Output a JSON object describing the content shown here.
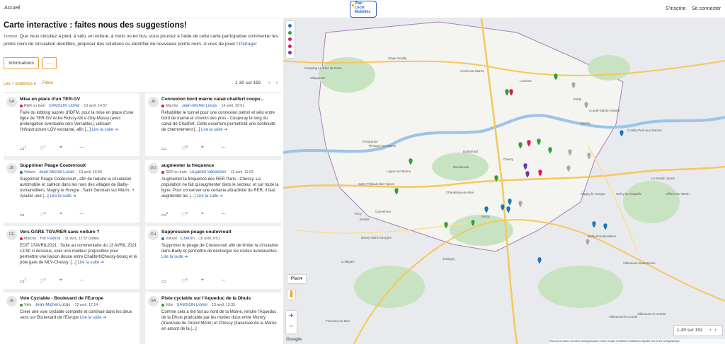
{
  "topbar": {
    "home": "Accueil",
    "logo_line1": "Plan",
    "logo_line2": "Local",
    "logo_line3": "Mobilités",
    "signup": "S'inscrire",
    "login": "Se connecter"
  },
  "header": {
    "title": "Carte interactive : faites nous des suggestions!",
    "status": "Terminé",
    "description": "Que vous circuliez à pied, à vélo, en voiture, à moto ou en bus, vous pourrez à l'aide de cette carte participative commenter les points noirs de circulation identifiés, proposer des solutions ou identifier de nouveaux points noirs. A vous de jouer ! ",
    "share": "Partager",
    "info_button": "Informations",
    "more_button": "···"
  },
  "filters": {
    "sort": "Les + soutenus ▾",
    "filter": "Filtrer",
    "pagination": "1-30 sur 192",
    "prev": "‹",
    "next": "›"
  },
  "colors": {
    "accent": "#e8a13a",
    "link": "#2b5fb4",
    "rer": "#e3165b",
    "marche": "#e3165b",
    "voiture": "#1f78b4",
    "velo": "#33a02c"
  },
  "cards": [
    {
      "initials": "SA",
      "title": "Mise en place d'un TER-GV",
      "category": "RER ou train",
      "cat_color": "#e3165b",
      "author": "SAMSON Lionel",
      "date": "· 13 avril, 14:57",
      "text": "Faire du lobbing auprès d'IDFM, pour la mise en place d'une ligne de TER-GV entre Roissy-MLV-Orly-Massy (avec prolongation éventuelle vers Versailles), utilisant l'infrastructure LGV existante, afin [...] ",
      "more": "Lire la suite ➔",
      "comments": "1",
      "likes": "7"
    },
    {
      "initials": "JE",
      "title": "Connexion bord marne canal chalifert coupv...",
      "category": "Marche",
      "cat_color": "#e3165b",
      "author": "Jean-Michel Lucas",
      "date": "· 14 avril, 20:01",
      "text": "Réhabiliter le tunnel pour une connexion piéton et vélo entre bord de marne et chemin des prés - Coupvray le long du canal de Chalifert. Cette ouverture permettrait une continuité de cheminement [...] ",
      "more": "Lire la suite ➔",
      "comments": "",
      "likes": "6"
    },
    {
      "initials": "JE",
      "title": "Supprimer Péage Coutevroult",
      "category": "Voiture",
      "cat_color": "#1f78b4",
      "author": "Jean-Michel Lucas",
      "date": "· 13 avril, 16:59",
      "text": "Supprimer Péage Coutevroult , afin de reduire la circulation automobile et camion dans les rues des villages de Bailly-romainvilliers, Magny le Hongre , Saint Germain sur Morin . • Ajouter une [...] ",
      "more": "Lire la suite ➔",
      "comments": "",
      "likes": "4"
    },
    {
      "initials": "DU",
      "title": "augmenter la fréquence",
      "category": "RER ou train",
      "cat_color": "#e3165b",
      "author": "Dujardin Sébastien",
      "date": "· 12 avril, 11:03",
      "text": "Augmenter la fréquence des RER Paris - Chessy. La population ne fait qu'augmenter dans le secteur, et sur toute la ligne. Pour conserver une certaine attractivité du RER, il faut augmenter les [...] ",
      "more": "Lire la suite ➔",
      "comments": "2",
      "likes": "4"
    },
    {
      "initials": "FE",
      "title": "Vers GARE TGV/RER sans voiture ?",
      "category": "Marche",
      "cat_color": "#e3165b",
      "author": "Fer Patrick",
      "date": "· 11 avril, 12:37 (édité)",
      "text": "EDIT 17AVRIL2021 : Suite au commentaire du 13 AVRIL 2021 13:50 ci dessous, voici une meilleur proposition pour permettre une liaison douce entre Chalifert/Chessy-bourg et le pôle gare de MLV-Chessy. [...] ",
      "more": "Lire la suite ➔",
      "comments": "1",
      "likes": "4"
    },
    {
      "initials": "CH",
      "title": "Suppression péage coutevroult",
      "category": "Voiture",
      "cat_color": "#1f78b4",
      "author": "Cheron",
      "date": "· 16 avril, 9:51",
      "text": "Supprimer le péage de Coutevroult afin de limiter la circulation dans Bailly et permettre de décharger les routes avoisinantes. ",
      "more": "Lire la suite ➔",
      "comments": "",
      "likes": "4"
    },
    {
      "initials": "JE",
      "title": "Voie Cyclable - Boulevard de l'Europe",
      "category": "Vélo",
      "cat_color": "#33a02c",
      "author": "Jean-Michel Lucas",
      "date": "· 13 avril, 17:14",
      "text": "Creer une voie cyclable complète et continue dans les deux sens sur Boulevard de l'Europe ",
      "more": "Lire la suite ➔",
      "comments": "",
      "likes": ""
    },
    {
      "initials": "SA",
      "title": "Piste cyclable sur l'Aqueduc de la Dhuis",
      "category": "Vélo",
      "cat_color": "#33a02c",
      "author": "SAMSON Lionel",
      "date": "· 13 avril, 13:35",
      "text": "Comme cela a été fait au nord de la Marne, rendre l'Aqueduc de la Dhuis praticable par les modes doux entre Montry (traversée du Grand Morin) et Chessy (traversée de la Marne en amont de la [...] ",
      "more": "",
      "comments": "",
      "likes": ""
    }
  ],
  "map": {
    "legend": [
      "#1f78b4",
      "#33a02c",
      "#e3165b",
      "#e3165b",
      "#6a3d9a"
    ],
    "plan_button": "Plan",
    "zoom_in": "+",
    "zoom_out": "−",
    "pagination": "1-30 sur 192",
    "google": "Google",
    "footer": "Raccourcis clavier   Données cartographiques ©2021 Google   Conditions d'utilisation   Signaler une erreur cartographique",
    "places": [
      "Villeparisis",
      "Camping Le Parc de Paris",
      "Claye-Souilly",
      "Annet-sur-Marne",
      "Lesches",
      "Esbly",
      "Condé-Sainte-Libiaire",
      "Montry",
      "Couilly-Pont-aux-Dames",
      "Thorigny-sur-Marne",
      "Pomponne",
      "Dampmart",
      "Chessy",
      "Lagny-sur-Marne",
      "Montévrain",
      "Saint-Thibault-des-Vignes",
      "Bussy-Saint-Georges",
      "Serris",
      "Magny-le-Hongre",
      "Bailly-Romainvilliers",
      "Villeneuve-le-Comte",
      "Ferrières-en-Brie",
      "Jossigny",
      "Collégien",
      "Torcy",
      "Noisiel",
      "Gouvernes",
      "Chanteloup-en-Brie",
      "Le Moulin Jaune",
      "Villiers-sur-Morin",
      "Crécy-la-Chapelle",
      "Villeneuve-Saint-Denis",
      "Villeneuve-le-Comte"
    ]
  }
}
